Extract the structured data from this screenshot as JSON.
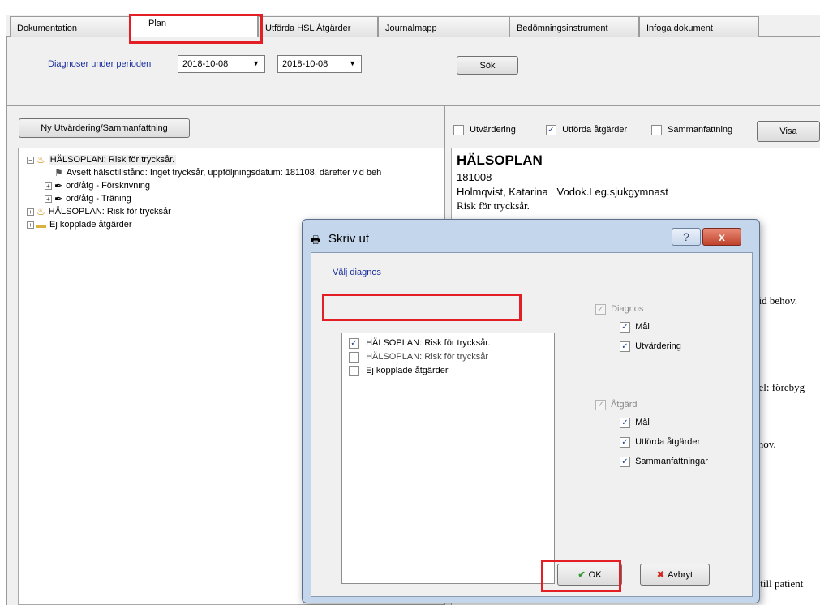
{
  "tabs": [
    "Dokumentation",
    "Plan",
    "Utförda HSL Åtgärder",
    "Journalmapp",
    "Bedömningsinstrument",
    "Infoga dokument"
  ],
  "toolbar": {
    "label": "Diagnoser under perioden",
    "date_from": "2018-10-08",
    "date_to": "2018-10-08",
    "search_button": "Sök"
  },
  "left": {
    "new_button": "Ny Utvärdering/Sammanfattning",
    "tree": [
      "HÄLSOPLAN: Risk för trycksår.",
      "Avsett hälsotillstånd: Inget trycksår, uppföljningsdatum: 181108, därefter vid beh",
      "ord/åtg - Förskrivning",
      "ord/åtg - Träning",
      "HÄLSOPLAN: Risk för trycksår",
      "Ej kopplade åtgärder"
    ]
  },
  "right": {
    "cb_utvardering": "Utvärdering",
    "cb_utforda": "Utförda åtgärder",
    "cb_sammanfattning": "Sammanfattning",
    "show_button": "Visa",
    "doc_title": "HÄLSOPLAN",
    "doc_date": "181008",
    "doc_author": "Holmqvist, Katarina   Vodok.Leg.sjukgymnast",
    "doc_diag": "Risk för trycksår.",
    "frag1": "vid behov.",
    "frag2": "del: förebyg",
    "frag3": "ehov.",
    "frag4": "s till patient"
  },
  "dialog": {
    "title": "Skriv ut",
    "help": "?",
    "close": "x",
    "section": "Välj diagnos",
    "list": [
      "HÄLSOPLAN: Risk för trycksår.",
      "HÄLSOPLAN: Risk för trycksår",
      "Ej kopplade åtgärder"
    ],
    "diagnos": "Diagnos",
    "diag_mal": "Mål",
    "diag_utv": "Utvärdering",
    "atgard": "Åtgärd",
    "atg_mal": "Mål",
    "atg_utf": "Utförda åtgärder",
    "atg_samm": "Sammanfattningar",
    "ok": "OK",
    "cancel": "Avbryt"
  },
  "check_glyph": "✓",
  "colors": {
    "highlight": "#e31e24",
    "label_blue": "#1a2f9c",
    "dialog_frame": "#c4d6ec"
  }
}
